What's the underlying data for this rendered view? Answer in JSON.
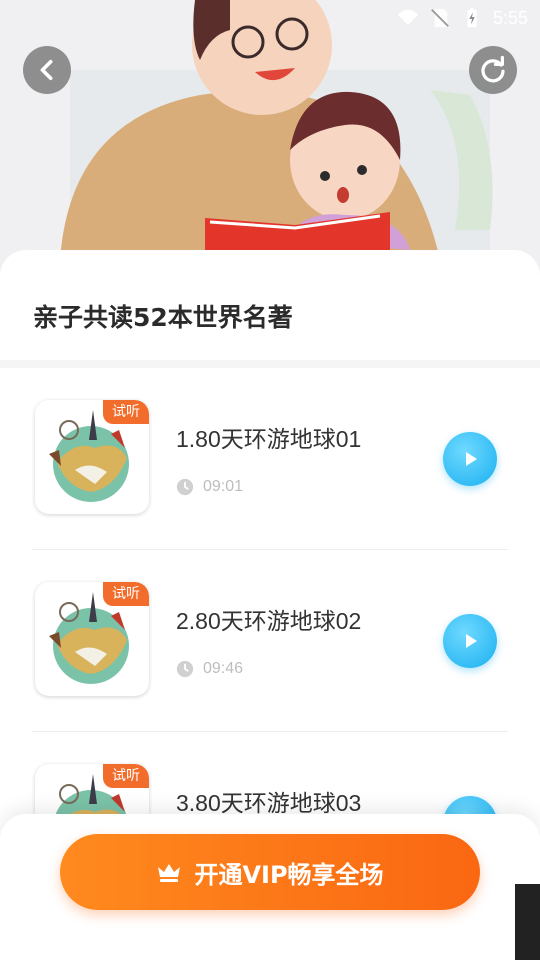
{
  "status_bar": {
    "time": "5:55"
  },
  "header": {
    "back_icon": "back-arrow-icon",
    "refresh_icon": "refresh-icon"
  },
  "album": {
    "title": "亲子共读52本世界名著"
  },
  "tracks": [
    {
      "title": "1.80天环游地球01",
      "duration": "09:01",
      "badge": "试听"
    },
    {
      "title": "2.80天环游地球02",
      "duration": "09:46",
      "badge": "试听"
    },
    {
      "title": "3.80天环游地球03",
      "duration": "",
      "badge": "试听"
    }
  ],
  "footer": {
    "vip_label": "开通VIP畅享全场",
    "vip_icon": "crown-icon"
  },
  "colors": {
    "accent_orange": "#fa6712",
    "play_blue": "#1ab0f0",
    "badge_orange": "#f26d2c"
  }
}
